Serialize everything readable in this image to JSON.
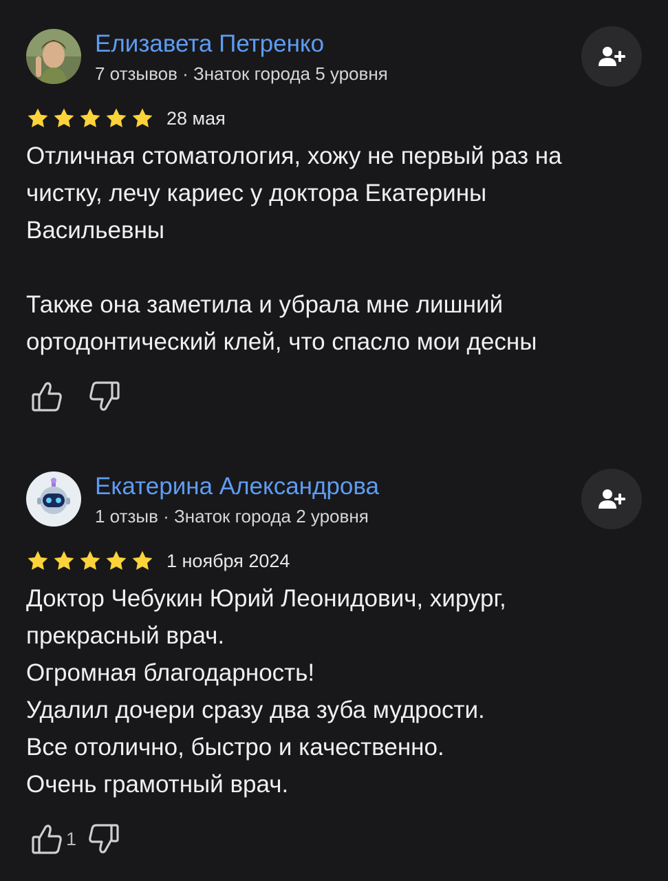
{
  "reviews": [
    {
      "author": "Елизавета Петренко",
      "meta": "7 отзывов · Знаток города 5 уровня",
      "subscribe_icon": "add-user-icon",
      "rating": 5,
      "rating_max": 5,
      "date": "28 мая",
      "text": [
        "Отличная стоматология, хожу не первый раз на",
        "чистку, лечу кариес у доктора Екатерины",
        "Васильевны",
        "",
        "Также она заметила и убрала мне лишний",
        "ортодонтический клей, что спасло мои десны"
      ],
      "like_icon": "thumbs-up-icon",
      "dislike_icon": "thumbs-down-icon",
      "likes": ""
    },
    {
      "author": "Екатерина Александрова",
      "meta": "1 отзыв · Знаток города 2 уровня",
      "subscribe_icon": "add-user-icon",
      "rating": 5,
      "rating_max": 5,
      "date": "1 ноября 2024",
      "text": [
        "Доктор Чебукин Юрий Леонидович, хирург,",
        "прекрасный врач.",
        "Огромная благодарность!",
        "Удалил дочери сразу два зуба мудрости.",
        "Все отолично, быстро и качественно.",
        "Очень грамотный врач."
      ],
      "like_icon": "thumbs-up-icon",
      "dislike_icon": "thumbs-down-icon",
      "likes": "1"
    }
  ],
  "colors": {
    "background": "#18181a",
    "author_name": "#5e9cf3",
    "star": "#fcd33a",
    "button_bg": "#2a2a2c"
  }
}
